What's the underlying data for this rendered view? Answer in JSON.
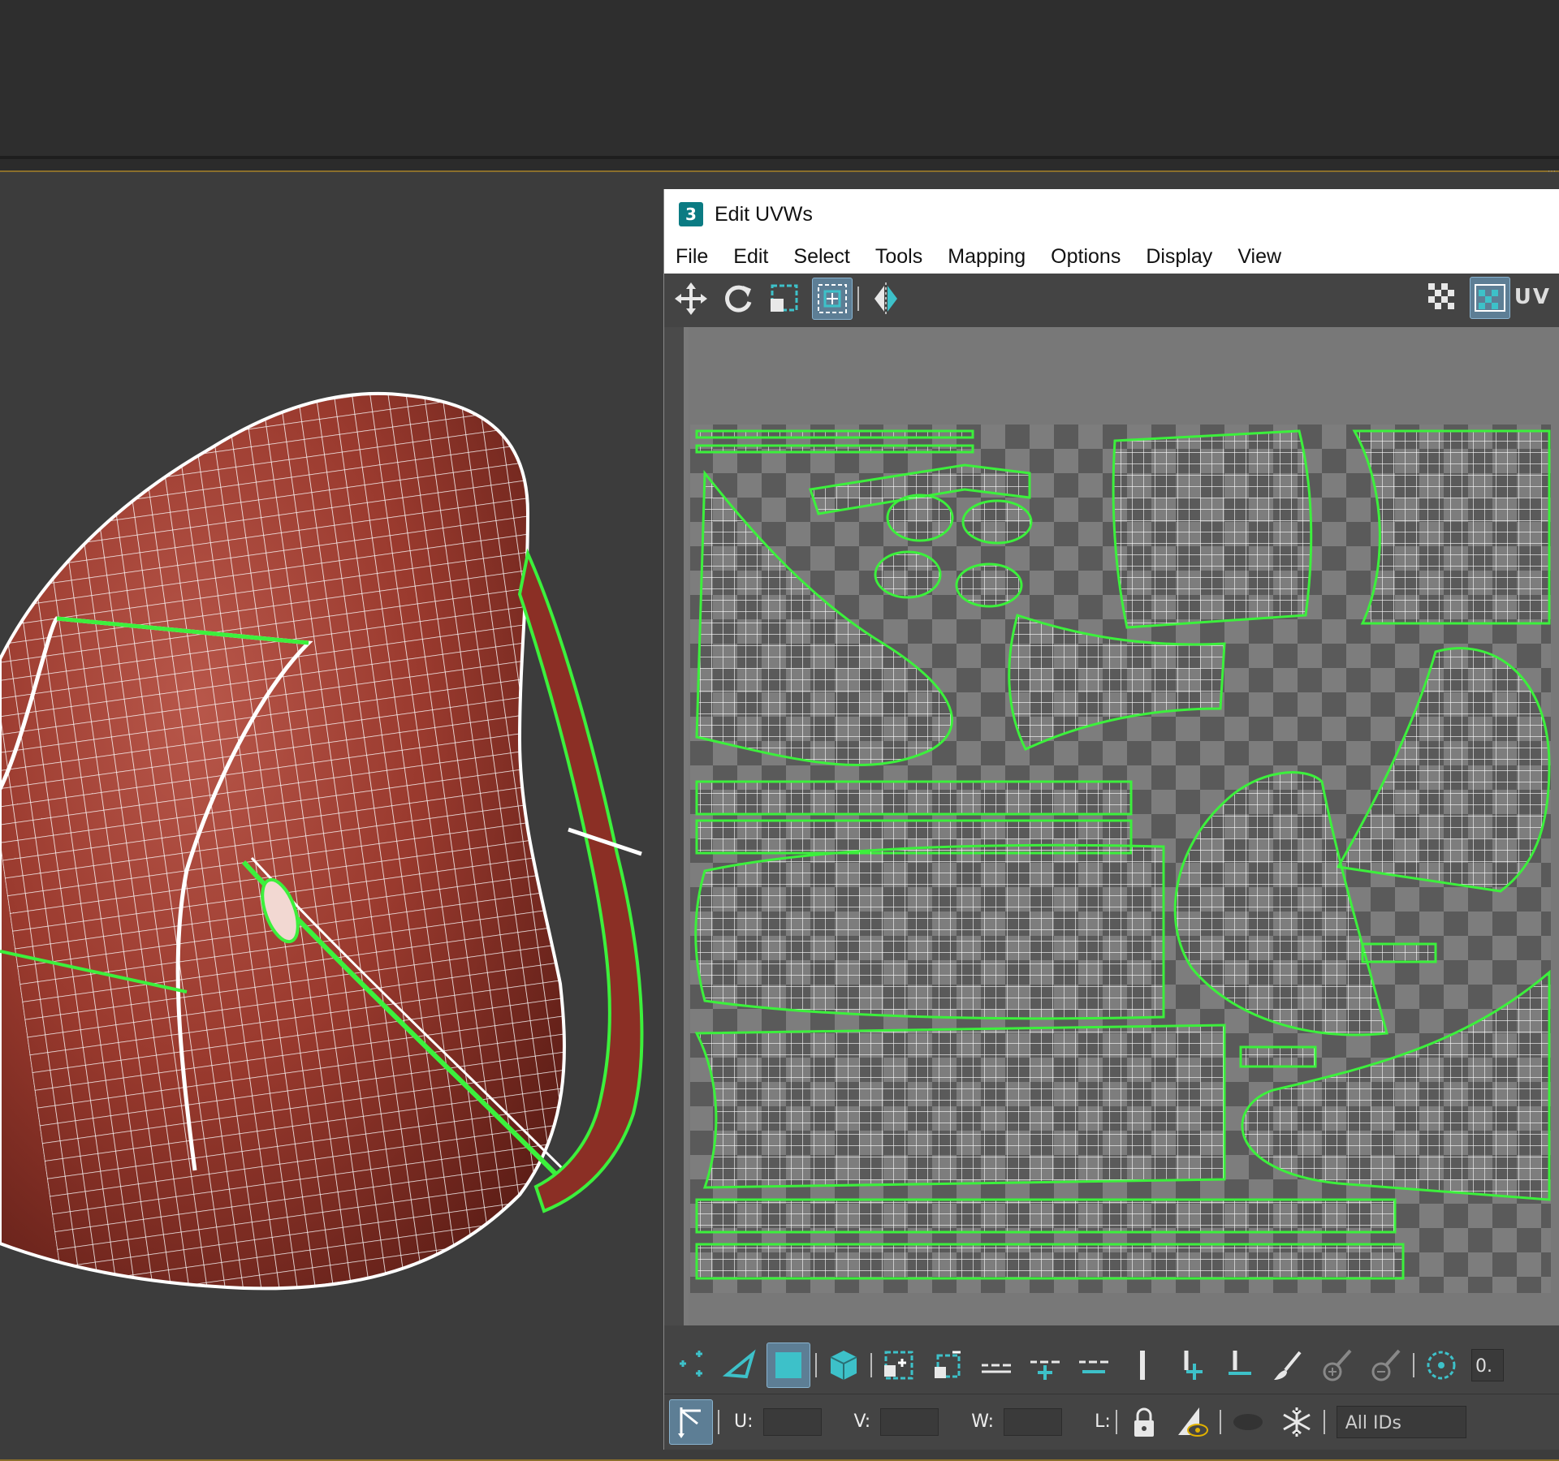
{
  "window": {
    "title": "Edit UVWs",
    "app_icon_label": "3"
  },
  "menu": [
    "File",
    "Edit",
    "Select",
    "Tools",
    "Mapping",
    "Options",
    "Display",
    "View"
  ],
  "toolbar_top": {
    "uv_label": "UV",
    "tools": [
      "move-icon",
      "rotate-icon",
      "scale-icon",
      "freeform-icon",
      "mirror-icon"
    ],
    "right_tools": [
      "checker-pattern-icon",
      "checker-map-icon"
    ]
  },
  "bottom_toolbar": {
    "tools": [
      "vertex-mode-icon",
      "edge-mode-icon",
      "polygon-mode-icon",
      "element-mode-icon",
      "grow-selection-icon",
      "shrink-selection-icon",
      "loop-icon",
      "loop-grow-icon",
      "loop-shrink-icon",
      "ring-icon",
      "ring-grow-icon",
      "ring-shrink-icon",
      "paint-select-icon",
      "paint-grow-icon",
      "paint-shrink-icon",
      "soft-selection-icon"
    ],
    "truncated_value": "0."
  },
  "coords_bar": {
    "u_label": "U:",
    "v_label": "V:",
    "w_label": "W:",
    "l_label": "L:",
    "u_value": "",
    "v_value": "",
    "w_value": "",
    "ids_value": "All IDs"
  },
  "colors": {
    "accent": "#3dc1c9",
    "seam_green": "#3cf03c",
    "bag_red": "#8f3328",
    "titlebar": "#ffffff"
  }
}
